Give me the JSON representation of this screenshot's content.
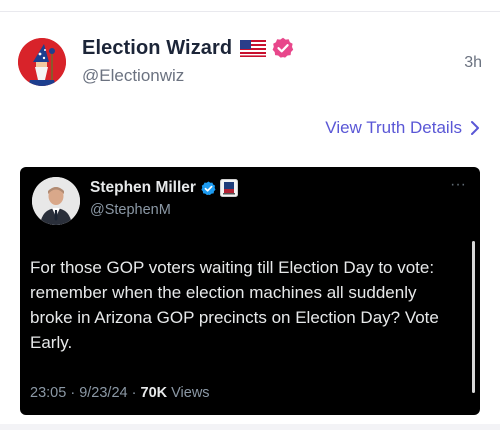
{
  "post": {
    "display_name": "Election Wizard",
    "flag_icon": "us-flag-icon",
    "verified_icon": "verified-badge-icon",
    "verified_color": "#e8478b",
    "handle": "@Electionwiz",
    "time": "3h"
  },
  "actions": {
    "view_details": "View Truth Details"
  },
  "embed": {
    "name": "Stephen Miller",
    "handle": "@StephenM",
    "verified_color": "#1d9bf0",
    "text": "For those GOP voters waiting till Election Day to vote: remember when the election machines all suddenly broke in Arizona GOP precincts on Election Day? Vote Early.",
    "time": "23:05",
    "date": "9/23/24",
    "separator": "·",
    "views_count": "70K",
    "views_label": "Views",
    "more_icon": "more-dots-icon",
    "more_glyph": "···"
  }
}
